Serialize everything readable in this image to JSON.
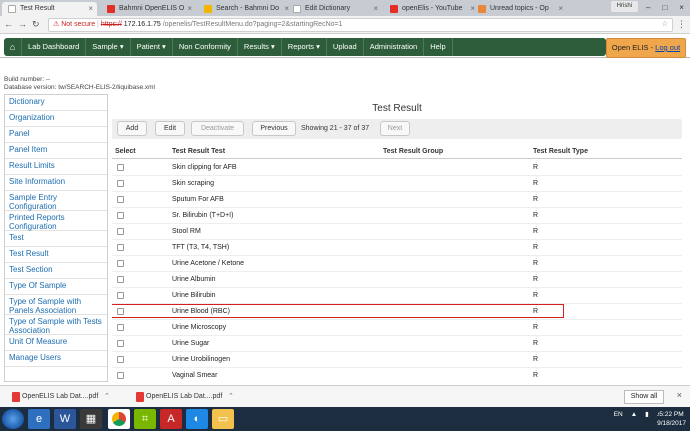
{
  "browser": {
    "tabs": [
      {
        "label": "Test Result",
        "active": true,
        "favicon": "page-icon"
      },
      {
        "label": "Bahmni OpenELIS O",
        "active": false,
        "favicon": "youtube-icon"
      },
      {
        "label": "Search - Bahmni Do",
        "active": false,
        "favicon": "page-icon"
      },
      {
        "label": "Edit Dictionary",
        "active": false,
        "favicon": "page-icon"
      },
      {
        "label": "openElis - YouTube",
        "active": false,
        "favicon": "youtube-icon"
      },
      {
        "label": "Unread topics - Op",
        "active": false,
        "favicon": "forum-icon"
      }
    ],
    "profile": "Hrishi",
    "address": {
      "warning": "Not secure",
      "scheme": "https://",
      "host": "172.16.1.75",
      "path": "/openelis/TestResultMenu.do?paging=2&startingRecNo=1"
    }
  },
  "nav": {
    "items": [
      "Lab Dashboard",
      "Sample",
      "Patient",
      "Non Conformity",
      "Results",
      "Reports",
      "Upload",
      "Administration",
      "Help"
    ],
    "brand": "Open ELIS",
    "logout": "Log out"
  },
  "build": {
    "number": "Build number: --",
    "db_version": "Database version: tw/SEARCH-ELIS-2/liquibase.xml"
  },
  "sidebar": {
    "items": [
      "Dictionary",
      "Organization",
      "Panel",
      "Panel Item",
      "Result Limits",
      "Site Information",
      "Sample Entry Configuration",
      "Printed Reports Configuration",
      "Test",
      "Test Result",
      "Test Section",
      "Type Of Sample",
      "Type of Sample with Panels Association",
      "Type of Sample with Tests Association",
      "Unit Of Measure",
      "Manage Users"
    ]
  },
  "main": {
    "title": "Test Result",
    "buttons": {
      "add": "Add",
      "edit": "Edit",
      "deactivate": "Deactivate",
      "previous": "Previous",
      "next": "Next"
    },
    "paging": "Showing 21 - 37 of 37",
    "columns": [
      "Select",
      "Test Result Test",
      "Test Result Group",
      "Test Result Type"
    ],
    "rows": [
      {
        "test": "Skin clipping for AFB",
        "group": "",
        "type": "R"
      },
      {
        "test": "Skin scraping",
        "group": "",
        "type": "R"
      },
      {
        "test": "Sputum For AFB",
        "group": "",
        "type": "R"
      },
      {
        "test": "Sr. Bilirubin (T+D+I)",
        "group": "",
        "type": "R"
      },
      {
        "test": "Stool RM",
        "group": "",
        "type": "R"
      },
      {
        "test": "TFT (T3, T4, TSH)",
        "group": "",
        "type": "R"
      },
      {
        "test": "Urine Acetone / Ketone",
        "group": "",
        "type": "R"
      },
      {
        "test": "Urine Albumin",
        "group": "",
        "type": "R"
      },
      {
        "test": "Urine Bilirubin",
        "group": "",
        "type": "R"
      },
      {
        "test": "Urine Blood (RBC)",
        "group": "",
        "type": "R",
        "highlighted": true
      },
      {
        "test": "Urine Microscopy",
        "group": "",
        "type": "R"
      },
      {
        "test": "Urine Sugar",
        "group": "",
        "type": "R"
      },
      {
        "test": "Urine Urobilinogen",
        "group": "",
        "type": "R"
      },
      {
        "test": "Vaginal Smear",
        "group": "",
        "type": "R"
      }
    ]
  },
  "downloads": {
    "items": [
      "OpenELIS Lab Dat....pdf",
      "OpenELIS Lab Dat....pdf"
    ],
    "show_all": "Show all"
  },
  "taskbar": {
    "lang": "EN",
    "time": "5:22 PM",
    "date": "9/18/2017"
  },
  "colors": {
    "nav_green": "#2d5d3a",
    "brand_orange": "#f0a64a",
    "link_blue": "#1c6db0",
    "highlight_red": "#d81d1d"
  }
}
